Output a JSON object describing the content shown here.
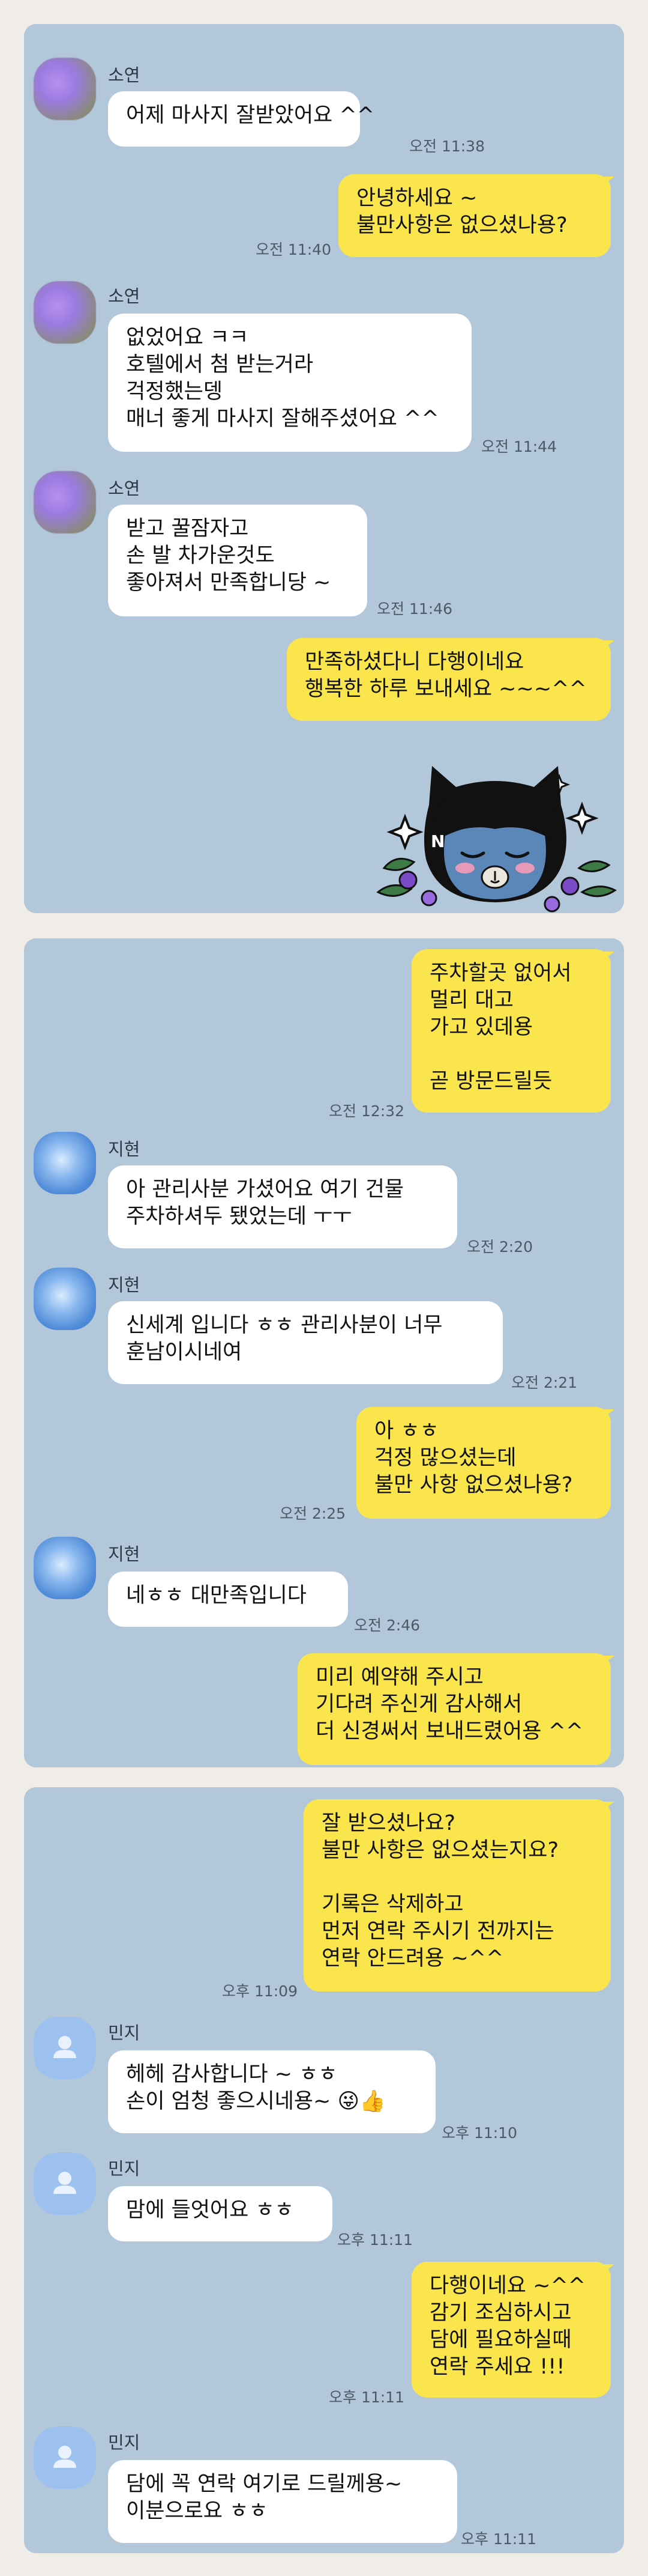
{
  "panels": [
    {
      "messages": [
        {
          "sender": "소연",
          "text": "어제 마사지 잘받았어요 ^^",
          "time": "오전 11:38"
        },
        {
          "self": true,
          "text": "안녕하세요 ~\n불만사항은 없으셨나용?",
          "time": "오전 11:40"
        },
        {
          "sender": "소연",
          "text": "없었어요 ㅋㅋ\n호텔에서 첨 받는거라\n걱정했는뎅\n매너 좋게 마사지 잘해주셨어요 ^^",
          "time": "오전 11:44"
        },
        {
          "sender": "소연",
          "text": "받고 꿀잠자고\n손 발 차가운것도\n좋아져서 만족합니당 ~",
          "time": "오전 11:46"
        },
        {
          "self": true,
          "text": "만족하셨다니 다행이네요\n행복한 하루 보내세요 ~~~^^",
          "time": ""
        }
      ],
      "sticker": "sleeping-cat-character-sticker"
    },
    {
      "messages": [
        {
          "self": true,
          "text": "주차할곳 없어서\n멀리 대고\n가고 있데용\n\n곧 방문드릴듯",
          "time": "오전 12:32"
        },
        {
          "sender": "지현",
          "text": "아 관리사분 가셨어요 여기 건물\n주차하셔두 됐었는데 ㅜㅜ",
          "time": "오전 2:20"
        },
        {
          "sender": "지현",
          "text": "신세계 입니다 ㅎㅎ 관리사분이 너무\n훈남이시네여",
          "time": "오전 2:21"
        },
        {
          "self": true,
          "text": "아 ㅎㅎ\n걱정 많으셨는데\n불만 사항 없으셨나용?",
          "time": "오전 2:25"
        },
        {
          "sender": "지현",
          "text": "네ㅎㅎ 대만족입니다",
          "time": "오전 2:46"
        },
        {
          "self": true,
          "text": "미리 예약해 주시고\n기다려 주신게 감사해서\n더 신경써서 보내드렸어용 ^^",
          "time": ""
        }
      ]
    },
    {
      "messages": [
        {
          "self": true,
          "text": "잘 받으셨나요?\n불만 사항은 없으셨는지요?\n\n기록은 삭제하고\n먼저 연락 주시기 전까지는\n연락 안드려용 ~^^",
          "time": "오후 11:09"
        },
        {
          "sender": "민지",
          "text": "헤헤 감사합니다 ~ ㅎㅎ\n손이 엄청 좋으시네용~ 😜👍",
          "time": "오후 11:10"
        },
        {
          "sender": "민지",
          "text": "맘에 들엇어요 ㅎㅎ",
          "time": "오후 11:11"
        },
        {
          "self": true,
          "text": "다행이네요 ~^^\n감기 조심하시고\n담에 필요하실때\n연락 주세요 !!!",
          "time": "오후 11:11"
        },
        {
          "sender": "민지",
          "text": "담에 꼭 연락 여기로 드릴께용~\n이분으로요 ㅎㅎ",
          "time": "오후 11:11"
        }
      ]
    }
  ],
  "colors": {
    "chat_bg": "#b2c7da",
    "self_bubble": "#fae54d",
    "other_bubble": "#ffffff",
    "page_bg": "#f0ece7"
  }
}
